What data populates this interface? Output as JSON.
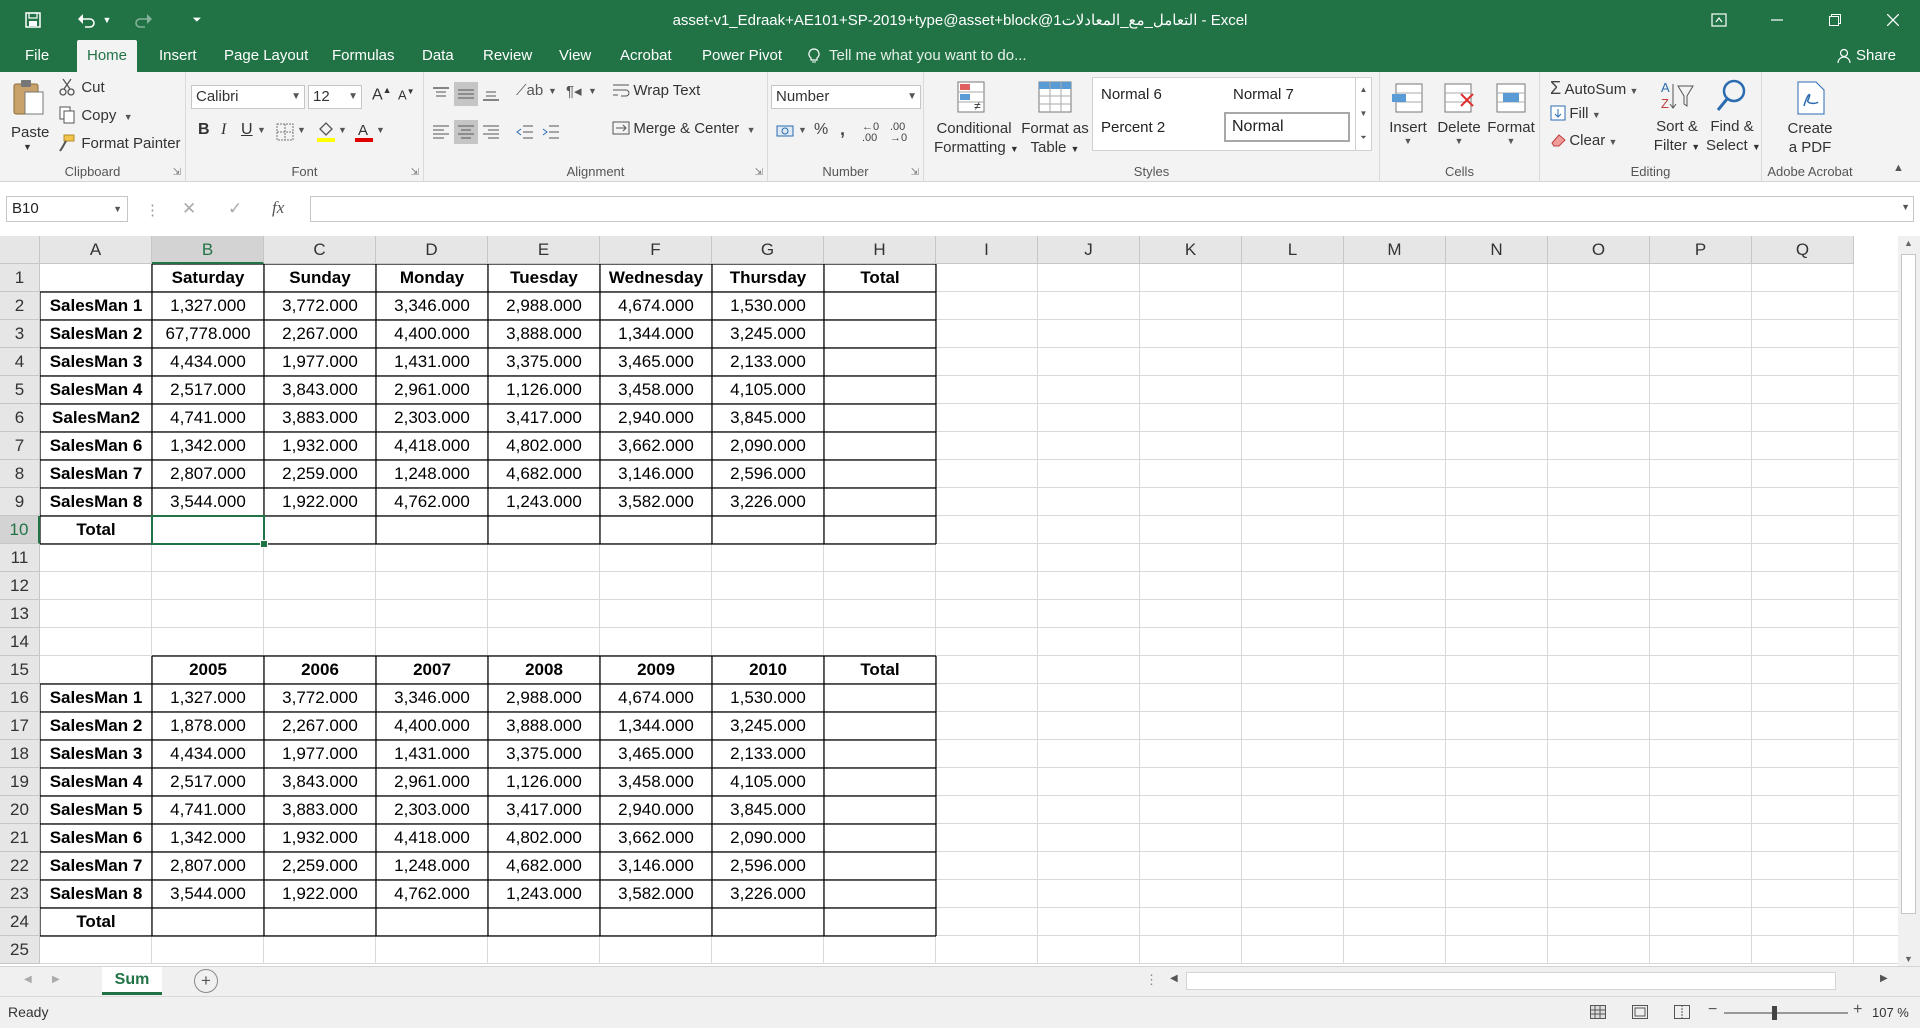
{
  "window": {
    "title": "asset-v1_Edraak+AE101+SP-2019+type@asset+block@1التعامل_مع_المعادلات - Excel",
    "share_label": "Share"
  },
  "menu_tabs": [
    "File",
    "Home",
    "Insert",
    "Page Layout",
    "Formulas",
    "Data",
    "Review",
    "View",
    "Acrobat",
    "Power Pivot"
  ],
  "tell_me": "Tell me what you want to do...",
  "ribbon": {
    "clipboard": {
      "paste": "Paste",
      "cut": "Cut",
      "copy": "Copy",
      "format_painter": "Format Painter",
      "label": "Clipboard"
    },
    "font": {
      "name": "Calibri",
      "size": "12",
      "label": "Font"
    },
    "alignment": {
      "wrap": "Wrap Text",
      "merge": "Merge & Center",
      "label": "Alignment"
    },
    "number": {
      "format": "Number",
      "label": "Number"
    },
    "styles": {
      "conditional": "Conditional",
      "conditional2": "Formatting",
      "format_as": "Format as",
      "format_as2": "Table",
      "normal6": "Normal 6",
      "normal7": "Normal 7",
      "percent2": "Percent 2",
      "normal": "Normal",
      "label": "Styles"
    },
    "cells": {
      "insert": "Insert",
      "delete": "Delete",
      "format": "Format",
      "label": "Cells"
    },
    "editing": {
      "autosum": "AutoSum",
      "fill": "Fill",
      "clear": "Clear",
      "sort": "Sort &",
      "sort2": "Filter",
      "find": "Find &",
      "find2": "Select",
      "label": "Editing"
    },
    "acrobat": {
      "create": "Create",
      "create2": "a PDF",
      "label": "Adobe Acrobat"
    }
  },
  "formula_bar": {
    "name_box": "B10",
    "formula": ""
  },
  "columns": [
    "A",
    "B",
    "C",
    "D",
    "E",
    "F",
    "G",
    "H",
    "I",
    "J",
    "K",
    "L",
    "M",
    "N",
    "O",
    "P",
    "Q"
  ],
  "rows": [
    "1",
    "2",
    "3",
    "4",
    "5",
    "6",
    "7",
    "8",
    "9",
    "10",
    "11",
    "12",
    "13",
    "14",
    "15",
    "16",
    "17",
    "18",
    "19",
    "20",
    "21",
    "22",
    "23",
    "24",
    "25"
  ],
  "table1": {
    "headers": [
      "",
      "Saturday",
      "Sunday",
      "Monday",
      "Tuesday",
      "Wednesday",
      "Thursday",
      "Total"
    ],
    "rows": [
      [
        "SalesMan 1",
        "1,327.000",
        "3,772.000",
        "3,346.000",
        "2,988.000",
        "4,674.000",
        "1,530.000",
        ""
      ],
      [
        "SalesMan 2",
        "67,778.000",
        "2,267.000",
        "4,400.000",
        "3,888.000",
        "1,344.000",
        "3,245.000",
        ""
      ],
      [
        "SalesMan 3",
        "4,434.000",
        "1,977.000",
        "1,431.000",
        "3,375.000",
        "3,465.000",
        "2,133.000",
        ""
      ],
      [
        "SalesMan 4",
        "2,517.000",
        "3,843.000",
        "2,961.000",
        "1,126.000",
        "3,458.000",
        "4,105.000",
        ""
      ],
      [
        "SalesMan2",
        "4,741.000",
        "3,883.000",
        "2,303.000",
        "3,417.000",
        "2,940.000",
        "3,845.000",
        ""
      ],
      [
        "SalesMan 6",
        "1,342.000",
        "1,932.000",
        "4,418.000",
        "4,802.000",
        "3,662.000",
        "2,090.000",
        ""
      ],
      [
        "SalesMan 7",
        "2,807.000",
        "2,259.000",
        "1,248.000",
        "4,682.000",
        "3,146.000",
        "2,596.000",
        ""
      ],
      [
        "SalesMan 8",
        "3,544.000",
        "1,922.000",
        "4,762.000",
        "1,243.000",
        "3,582.000",
        "3,226.000",
        ""
      ]
    ],
    "total_label": "Total"
  },
  "table2": {
    "headers": [
      "",
      "2005",
      "2006",
      "2007",
      "2008",
      "2009",
      "2010",
      "Total"
    ],
    "rows": [
      [
        "SalesMan 1",
        "1,327.000",
        "3,772.000",
        "3,346.000",
        "2,988.000",
        "4,674.000",
        "1,530.000",
        ""
      ],
      [
        "SalesMan 2",
        "1,878.000",
        "2,267.000",
        "4,400.000",
        "3,888.000",
        "1,344.000",
        "3,245.000",
        ""
      ],
      [
        "SalesMan 3",
        "4,434.000",
        "1,977.000",
        "1,431.000",
        "3,375.000",
        "3,465.000",
        "2,133.000",
        ""
      ],
      [
        "SalesMan 4",
        "2,517.000",
        "3,843.000",
        "2,961.000",
        "1,126.000",
        "3,458.000",
        "4,105.000",
        ""
      ],
      [
        "SalesMan 5",
        "4,741.000",
        "3,883.000",
        "2,303.000",
        "3,417.000",
        "2,940.000",
        "3,845.000",
        ""
      ],
      [
        "SalesMan 6",
        "1,342.000",
        "1,932.000",
        "4,418.000",
        "4,802.000",
        "3,662.000",
        "2,090.000",
        ""
      ],
      [
        "SalesMan 7",
        "2,807.000",
        "2,259.000",
        "1,248.000",
        "4,682.000",
        "3,146.000",
        "2,596.000",
        ""
      ],
      [
        "SalesMan 8",
        "3,544.000",
        "1,922.000",
        "4,762.000",
        "1,243.000",
        "3,582.000",
        "3,226.000",
        ""
      ]
    ],
    "total_label": "Total"
  },
  "sheet_tab": "Sum",
  "status": {
    "ready": "Ready",
    "zoom": "107 %"
  },
  "colors": {
    "accent": "#217346",
    "header_bg": "#e6e6e6",
    "grid_line": "#d9d9d9"
  }
}
